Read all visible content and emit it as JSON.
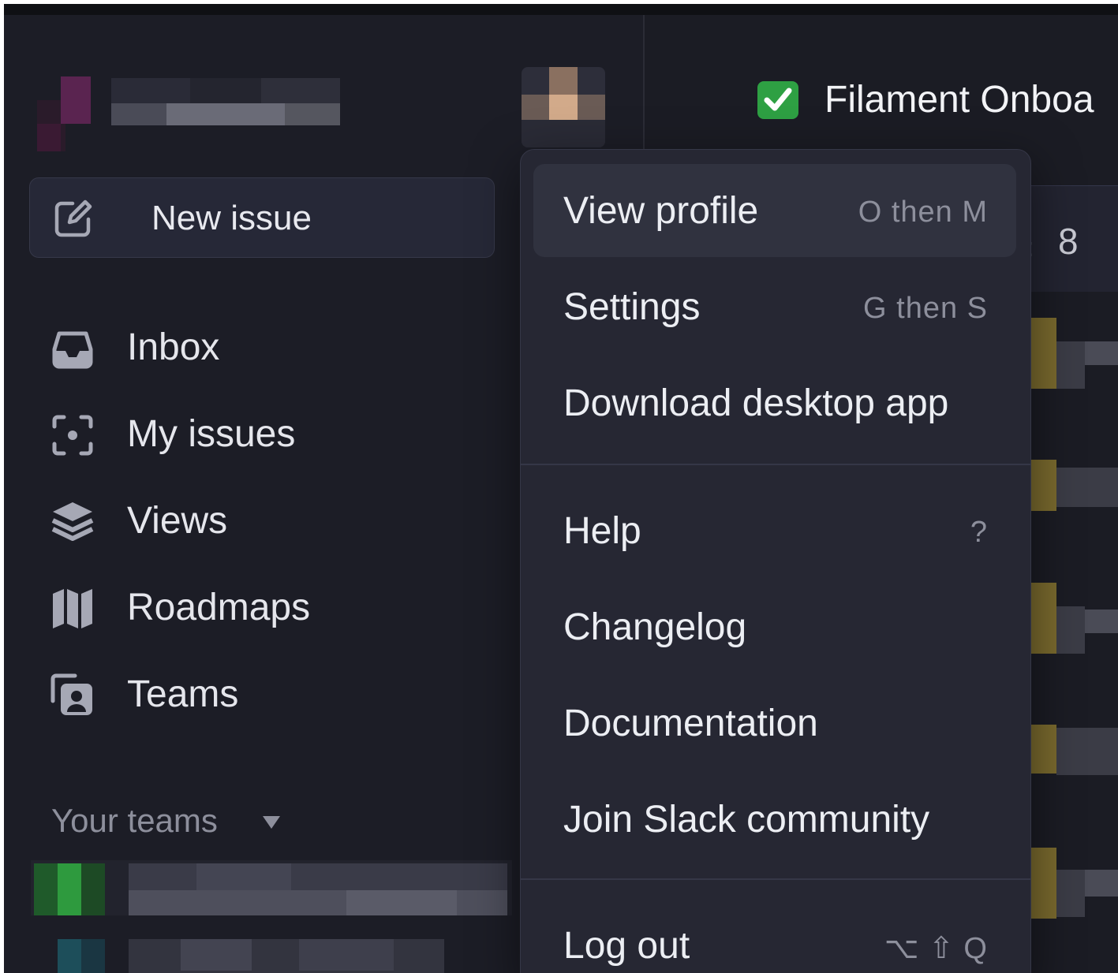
{
  "sidebar": {
    "new_issue_label": "New issue",
    "nav": [
      {
        "label": "Inbox",
        "icon": "inbox-icon"
      },
      {
        "label": "My issues",
        "icon": "focus-icon"
      },
      {
        "label": "Views",
        "icon": "layers-icon"
      },
      {
        "label": "Roadmaps",
        "icon": "map-icon"
      },
      {
        "label": "Teams",
        "icon": "teams-icon"
      }
    ],
    "teams_header": "Your teams"
  },
  "issue": {
    "emoji": "✅",
    "title": "Filament Onboa",
    "count": "8"
  },
  "menu": {
    "items": [
      {
        "label": "View profile",
        "shortcut": "O then M"
      },
      {
        "label": "Settings",
        "shortcut": "G then S"
      },
      {
        "label": "Download desktop app",
        "shortcut": ""
      },
      {
        "label": "Help",
        "shortcut": "?"
      },
      {
        "label": "Changelog",
        "shortcut": ""
      },
      {
        "label": "Documentation",
        "shortcut": ""
      },
      {
        "label": "Join Slack community",
        "shortcut": ""
      },
      {
        "label": "Log out",
        "shortcut": "⌥ ⇧ Q"
      }
    ]
  },
  "colors": {
    "background": "#1b1c24",
    "menu": "#262733",
    "accent_green": "#2ea043",
    "muted": "#8d8f9c"
  }
}
